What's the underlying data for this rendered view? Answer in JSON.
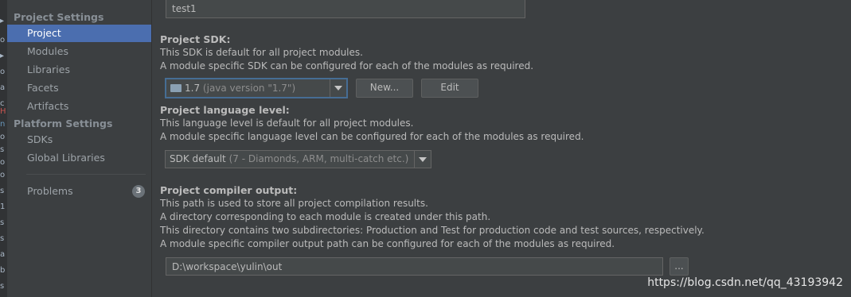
{
  "gutter_chars": [
    "▸",
    "o",
    "▸",
    "o",
    "a",
    "c",
    "H",
    "n",
    "o",
    "s",
    "o",
    "o",
    "s",
    "1",
    "s",
    "s",
    "a",
    "b",
    "s"
  ],
  "sidebar": {
    "project_settings_heading": "Project Settings",
    "project_items": [
      "Project",
      "Modules",
      "Libraries",
      "Facets",
      "Artifacts"
    ],
    "platform_settings_heading": "Platform Settings",
    "platform_items": [
      "SDKs",
      "Global Libraries"
    ],
    "problems_label": "Problems",
    "problems_count": "3"
  },
  "main": {
    "project_name_value": "test1",
    "sdk_heading": "Project SDK:",
    "sdk_desc_1": "This SDK is default for all project modules.",
    "sdk_desc_2": "A module specific SDK can be configured for each of the modules as required.",
    "sdk_selected": "1.7",
    "sdk_selected_detail": "(java version \"1.7\")",
    "new_button": "New...",
    "edit_button": "Edit",
    "lang_heading": "Project language level:",
    "lang_desc_1": "This language level is default for all project modules.",
    "lang_desc_2": "A module specific language level can be configured for each of the modules as required.",
    "lang_selected": "SDK default",
    "lang_selected_detail": "(7 - Diamonds, ARM, multi-catch etc.)",
    "output_heading": "Project compiler output:",
    "output_desc_1": "This path is used to store all project compilation results.",
    "output_desc_2": "A directory corresponding to each module is created under this path.",
    "output_desc_3": "This directory contains two subdirectories: Production and Test for production code and test sources, respectively.",
    "output_desc_4": "A module specific compiler output path can be configured for each of the modules as required.",
    "output_path_value": "D:\\workspace\\yulin\\out",
    "browse_button": "..."
  },
  "watermark": "https://blog.csdn.net/qq_43193942",
  "colors": {
    "background": "#3c3f41",
    "selection": "#4b6eaf",
    "text": "#bbbbbb",
    "field": "#45494a"
  }
}
